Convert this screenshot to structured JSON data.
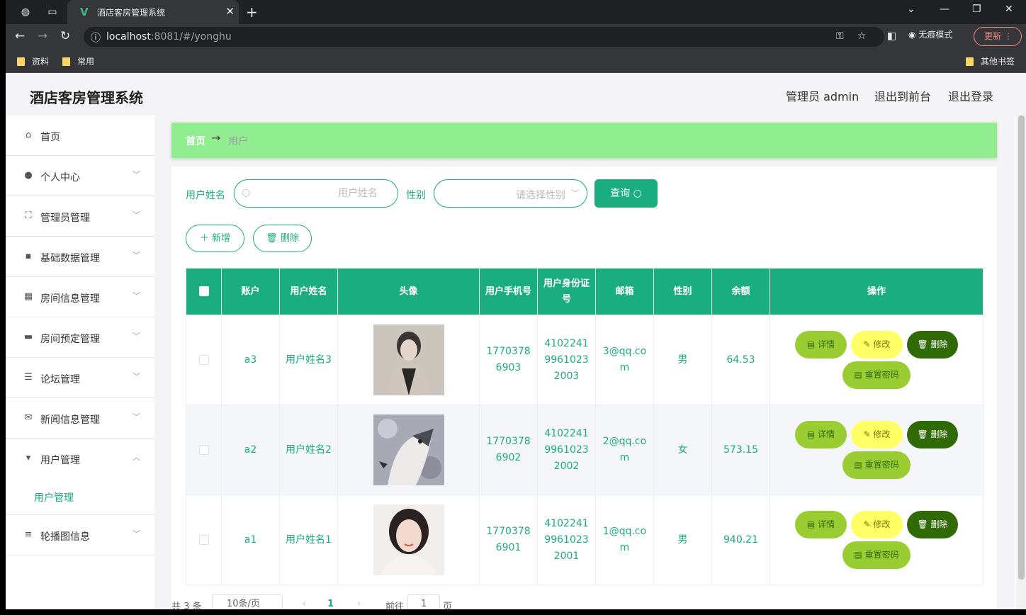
{
  "browser": {
    "tab_title": "酒店客房管理系统",
    "url_host": "localhost",
    "url_rest": ":8081/#/yonghu",
    "incognito_label": "无痕模式",
    "update_label": "更新",
    "bookmarks": [
      "资料",
      "常用"
    ],
    "other_bookmarks": "其他书签"
  },
  "header": {
    "title": "酒店客房管理系统",
    "admin": "管理员 admin",
    "front": "退出到前台",
    "logout": "退出登录"
  },
  "sidebar": {
    "items": [
      {
        "label": "首页",
        "icon": "home-icon"
      },
      {
        "label": "个人中心",
        "icon": "user-icon"
      },
      {
        "label": "管理员管理",
        "icon": "fullscreen-icon"
      },
      {
        "label": "基础数据管理",
        "icon": "message-icon"
      },
      {
        "label": "房间信息管理",
        "icon": "grid-icon"
      },
      {
        "label": "房间预定管理",
        "icon": "briefcase-icon"
      },
      {
        "label": "论坛管理",
        "icon": "sliders-icon"
      },
      {
        "label": "新闻信息管理",
        "icon": "mail-icon"
      },
      {
        "label": "用户管理",
        "icon": "brush-icon"
      },
      {
        "label": "轮播图信息",
        "icon": "list-icon"
      }
    ],
    "sub_item": "用户管理"
  },
  "breadcrumb": {
    "home": "首页",
    "arrow": "→",
    "current": "用户"
  },
  "filters": {
    "name_label": "用户姓名",
    "name_placeholder": "用户姓名",
    "gender_label": "性别",
    "gender_placeholder": "请选择性别",
    "query_label": "查询"
  },
  "actions": {
    "add": "新增",
    "delete": "删除"
  },
  "table": {
    "columns": [
      "账户",
      "用户姓名",
      "头像",
      "用户手机号",
      "用户身份证号",
      "邮箱",
      "性别",
      "余额",
      "操作"
    ],
    "rows": [
      {
        "account": "a3",
        "name": "用户姓名3",
        "phone": "17703786903",
        "idno": "410224199610232003",
        "email": "3@qq.com",
        "gender": "男",
        "balance": "64.53"
      },
      {
        "account": "a2",
        "name": "用户姓名2",
        "phone": "17703786902",
        "idno": "410224199610232002",
        "email": "2@qq.com",
        "gender": "女",
        "balance": "573.15"
      },
      {
        "account": "a1",
        "name": "用户姓名1",
        "phone": "17703786901",
        "idno": "410224199610232001",
        "email": "1@qq.com",
        "gender": "男",
        "balance": "940.21"
      }
    ],
    "row_actions": {
      "detail": "详情",
      "edit": "修改",
      "delete": "删除",
      "reset": "重置密码"
    }
  },
  "pagination": {
    "total": "共 3 条",
    "page_size": "10条/页",
    "current_page": "1",
    "goto_label": "前往",
    "goto_value": "1",
    "page_unit": "页"
  },
  "colors": {
    "primary": "#1aad7e",
    "breadcrumb_bg": "#90ee90",
    "detail": "#9acd32",
    "edit": "#ffff66",
    "delete": "#2f6a05"
  }
}
